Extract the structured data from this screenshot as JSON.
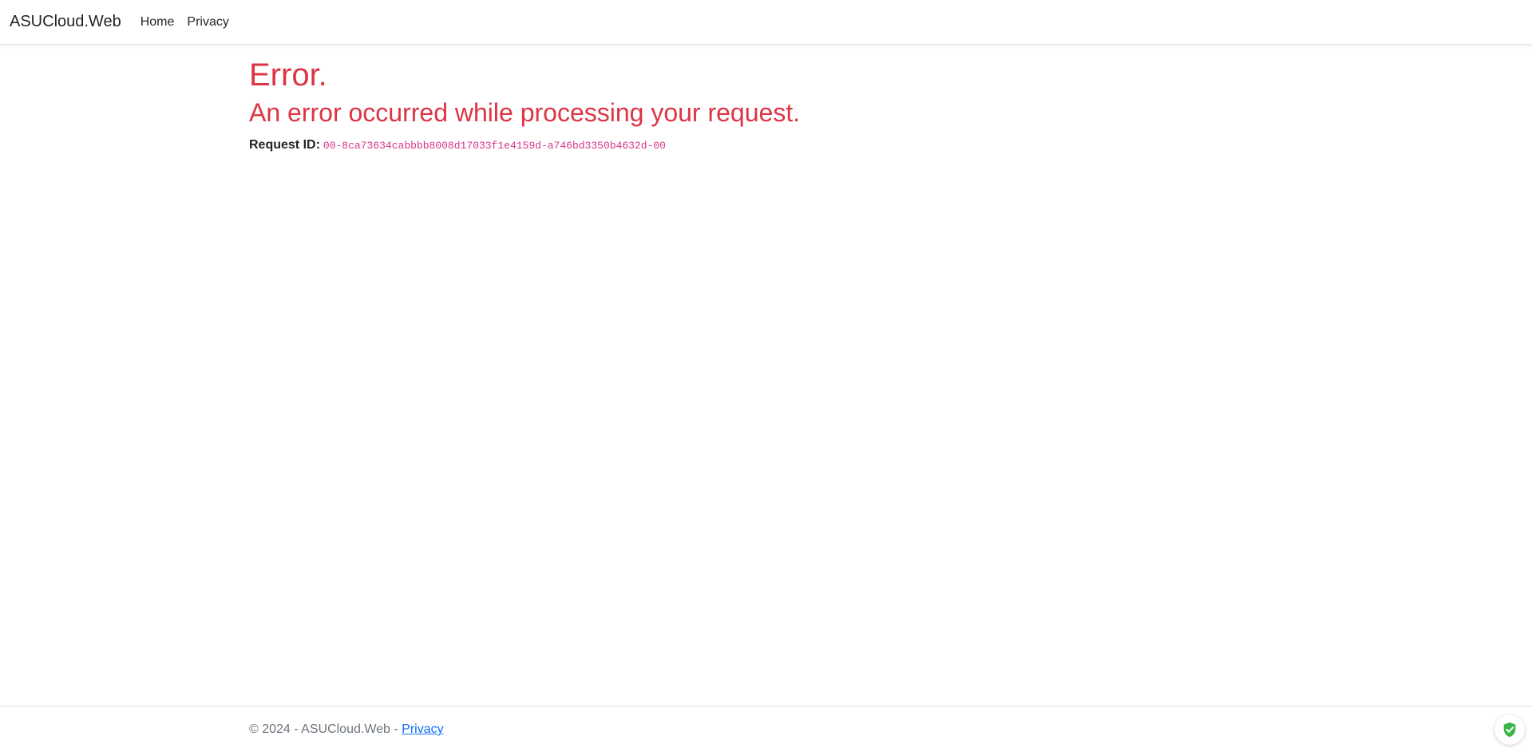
{
  "navbar": {
    "brand": "ASUCloud.Web",
    "links": [
      "Home",
      "Privacy"
    ]
  },
  "main": {
    "title": "Error.",
    "subtitle": "An error occurred while processing your request.",
    "request_label": "Request ID:",
    "request_id": "00-8ca73634cabbbb8008d17033f1e4159d-a746bd3350b4632d-00"
  },
  "footer": {
    "text": "© 2024 - ASUCloud.Web - ",
    "link": "Privacy"
  },
  "extension": {
    "icon": "shield-check-icon",
    "color": "#3bb54a"
  },
  "colors": {
    "error": "#dc3545",
    "code": "#d63384",
    "link": "#0d6efd"
  }
}
